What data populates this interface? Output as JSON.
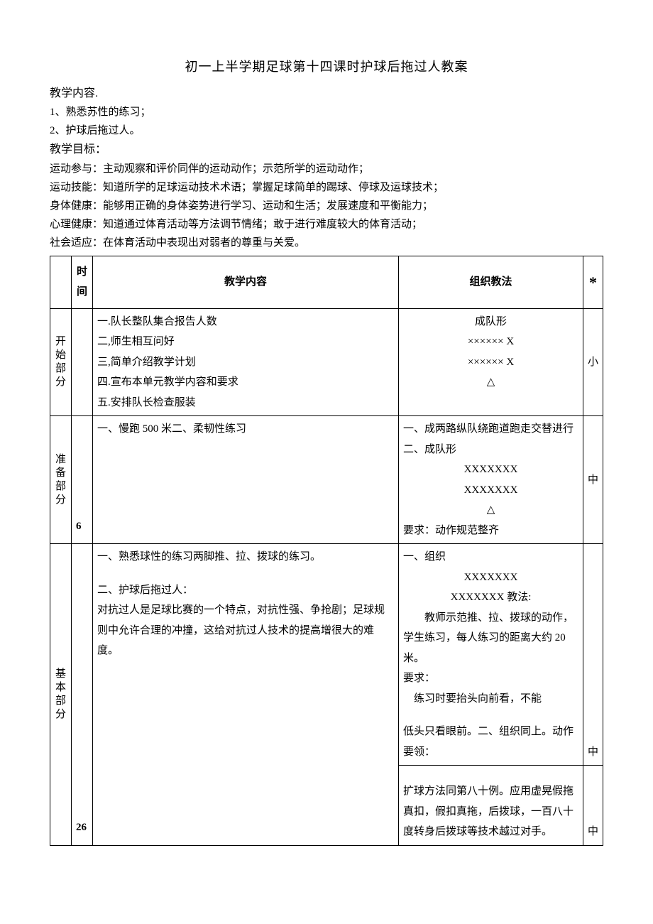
{
  "title": "初一上半学期足球第十四课时护球后拖过人教案",
  "headings": {
    "teaching_content": "教学内容.",
    "teaching_goal": "教学目标："
  },
  "content_items": {
    "c1": "1、熟悉苏性的练习；",
    "c2": "2、护球后拖过人。"
  },
  "goals": {
    "g1": "运动参与：主动观察和评价同伴的运动动作；示范所学的运动动作；",
    "g2": "运动技能：知道所学的足球运动技术术语；掌握足球简单的踢球、停球及运球技术；",
    "g3": "身体健康：能够用正确的身体姿势进行学习、运动和生活；发展速度和平衡能力；",
    "g4": "心理健康：知道通过体育活动等方法调节情绪；敢于进行难度较大的体育活动；",
    "g5": "社会适应：在体育活动中表现出对弱者的尊重与关爱。"
  },
  "table": {
    "headers": {
      "time": "时间",
      "content": "教学内容",
      "method": "组织教法",
      "star": "*"
    },
    "rows": {
      "start": {
        "phase": "开始部分",
        "content": {
          "l1": "一.队长整队集合报告人数",
          "l2": "二,师生相互问好",
          "l3": "三,简单介绍教学计划",
          "l4": "四.宣布本单元教学内容和要求",
          "l5": "五.安排队长检查服装"
        },
        "method": {
          "m1": "成队形",
          "m2": "×××××× X",
          "m3": "×××××× X",
          "m4": "△"
        },
        "intensity": "小"
      },
      "prep": {
        "phase": "准备部分",
        "time": "6",
        "content": {
          "l1": "一、慢跑 500 米二、柔韧性练习"
        },
        "method": {
          "m1": "一、成两路纵队绕跑道跑走交替进行",
          "m2": "二、成队形",
          "m3": "XXXXXXX",
          "m4": "XXXXXXX",
          "m5": "△",
          "m6": "要求：动作规范整齐"
        },
        "intensity": "中"
      },
      "main": {
        "phase": "基本部分",
        "time": "26",
        "content": {
          "l1": "一、熟悉球性的练习两脚推、拉、拨球的练习。",
          "l2": "二、护球后拖过人：",
          "l3": "对抗过人是足球比赛的一个特点，对抗性强、争抢剧；足球规则中允许合理的冲撞，这给对抗过人技术的提高增很大的难度。"
        },
        "method": {
          "m1": "一、组织",
          "m2": "XXXXXXX",
          "m3": "XXXXXXX 教法:",
          "m4": "　　教师示范推、拉、拨球的动作，学生练习，每人练习的距离大约 20 米。",
          "m5": "要求：",
          "m6": "　练习时要抬头向前看，不能",
          "m7": "低头只看眼前。二、组织同上。动作要领：",
          "m8": "扩球方法同第八十例。应用虚晃假拖真扣，假扣真拖，后拨球，一百八十度转身后拨球等技术越过对手。"
        },
        "intensity1": "中",
        "intensity2": "中"
      }
    }
  }
}
